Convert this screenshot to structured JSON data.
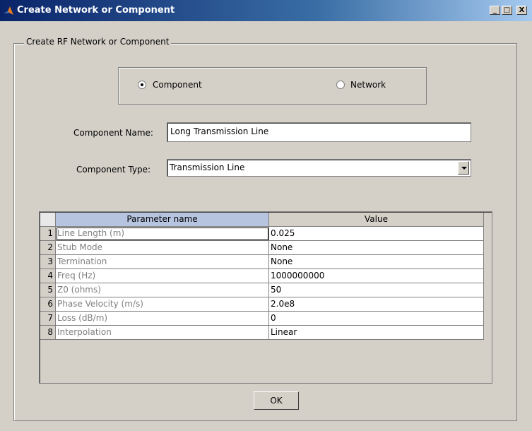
{
  "window": {
    "title": "Create Network or Component",
    "controls": {
      "minimize": "_",
      "maximize": "□",
      "close": "X"
    }
  },
  "group": {
    "legend": "Create RF Network or Component"
  },
  "mode": {
    "options": [
      {
        "label": "Component",
        "selected": true
      },
      {
        "label": "Network",
        "selected": false
      }
    ]
  },
  "form": {
    "name_label": "Component Name:",
    "name_value": "Long Transmission Line",
    "type_label": "Component Type:",
    "type_value": "Transmission Line"
  },
  "table": {
    "headers": [
      "Parameter name",
      "Value"
    ],
    "rows": [
      {
        "num": "1",
        "name": "Line Length (m)",
        "value": "0.025"
      },
      {
        "num": "2",
        "name": "Stub Mode",
        "value": "None"
      },
      {
        "num": "3",
        "name": "Termination",
        "value": "None"
      },
      {
        "num": "4",
        "name": "Freq (Hz)",
        "value": "1000000000"
      },
      {
        "num": "5",
        "name": "Z0 (ohms)",
        "value": "50"
      },
      {
        "num": "6",
        "name": "Phase Velocity (m/s)",
        "value": "2.0e8"
      },
      {
        "num": "7",
        "name": "Loss (dB/m)",
        "value": "0"
      },
      {
        "num": "8",
        "name": "Interpolation",
        "value": "Linear"
      }
    ]
  },
  "footer": {
    "ok_label": "OK"
  },
  "colors": {
    "title_start": "#0a246a",
    "title_end": "#a6caf0",
    "header_selected": "#b6c4e0",
    "window_bg": "#d4d0c8"
  }
}
